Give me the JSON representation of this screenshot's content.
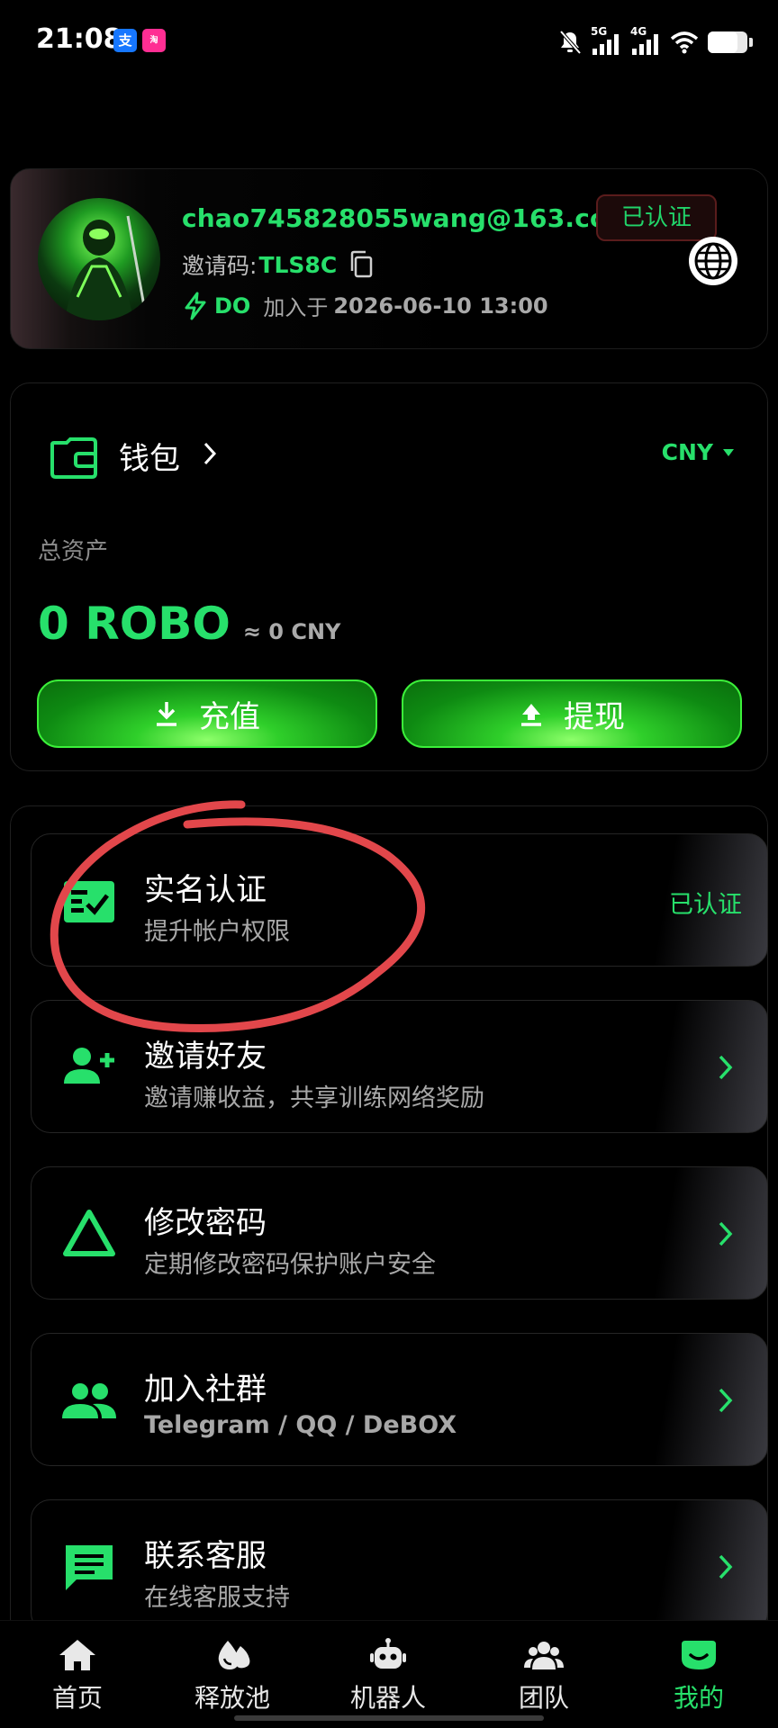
{
  "status_bar": {
    "time": "21:08",
    "app_icons": [
      "支",
      "淘"
    ],
    "signal_labels": [
      "5G",
      "4G"
    ],
    "battery_level": 0.75
  },
  "profile": {
    "email": "chao745828055wang@163.com",
    "verified_badge": "已认证",
    "invite_label": "邀请码:",
    "invite_code": "TLS8C",
    "level": "DO",
    "joined_label": "加入于",
    "joined_date": "2026-06-10 13:00"
  },
  "wallet": {
    "title": "钱包",
    "currency": "CNY",
    "total_label": "总资产",
    "total_value": "0 ROBO",
    "approx_value": "≈ 0 CNY",
    "recharge_label": "充值",
    "withdraw_label": "提现"
  },
  "menu": {
    "items": [
      {
        "title": "实名认证",
        "subtitle": "提升帐户权限",
        "right": "已认证",
        "icon": "id-check-icon"
      },
      {
        "title": "邀请好友",
        "subtitle": "邀请赚收益，共享训练网络奖励",
        "icon": "add-friend-icon"
      },
      {
        "title": "修改密码",
        "subtitle": "定期修改密码保护账户安全",
        "icon": "triangle-icon"
      },
      {
        "title": "加入社群",
        "subtitle": "Telegram / QQ / DeBOX",
        "icon": "group-icon"
      },
      {
        "title": "联系客服",
        "subtitle": "在线客服支持",
        "icon": "chat-icon"
      }
    ]
  },
  "bottom_nav": {
    "items": [
      {
        "label": "首页",
        "icon": "home-icon"
      },
      {
        "label": "释放池",
        "icon": "pool-icon"
      },
      {
        "label": "机器人",
        "icon": "robot-icon"
      },
      {
        "label": "团队",
        "icon": "team-icon"
      },
      {
        "label": "我的",
        "icon": "profile-icon",
        "active": true
      }
    ]
  },
  "colors": {
    "accent_green": "#27e06b",
    "background": "#000000",
    "annotation_red": "#e2474b"
  }
}
